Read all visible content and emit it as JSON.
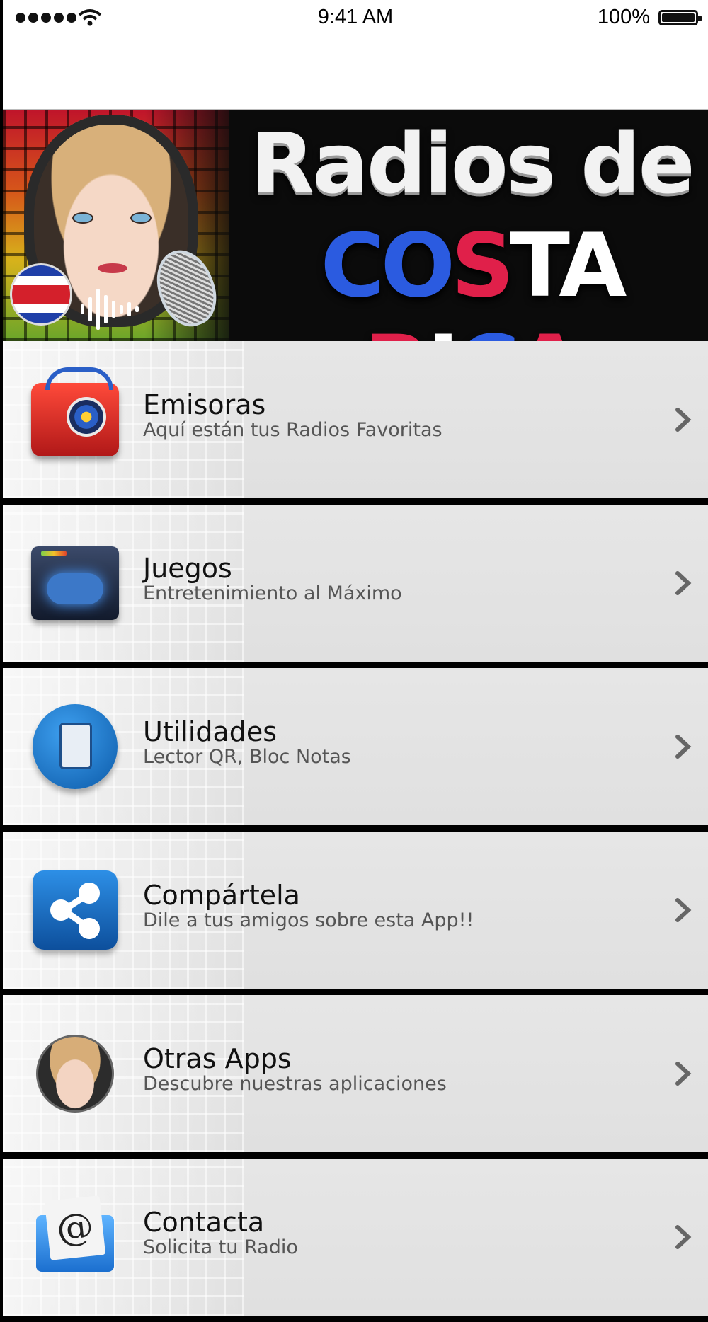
{
  "status_bar": {
    "time": "9:41 AM",
    "battery": "100%",
    "signal_icon": "signal-dots-icon",
    "wifi_icon": "wifi-icon",
    "battery_icon": "battery-icon"
  },
  "banner": {
    "line1": "Radios de",
    "line2_parts": [
      "CO",
      "S",
      "TA",
      " ",
      "R",
      "I",
      "C",
      "A"
    ],
    "colors": {
      "blue": "#2b5be0",
      "white": "#ffffff",
      "red": "#e0204a"
    }
  },
  "menu": {
    "items": [
      {
        "title": "Emisoras",
        "subtitle": "Aquí están tus Radios Favoritas",
        "icon": "radio-icon"
      },
      {
        "title": "Juegos",
        "subtitle": "Entretenimiento al Máximo",
        "icon": "gamepad-folder-icon"
      },
      {
        "title": "Utilidades",
        "subtitle": "Lector QR, Bloc Notas",
        "icon": "clipboard-icon"
      },
      {
        "title": "Compártela",
        "subtitle": "Dile a tus amigos sobre esta App!!",
        "icon": "share-icon"
      },
      {
        "title": "Otras Apps",
        "subtitle": "Descubre nuestras aplicaciones",
        "icon": "avatar-headphones-icon"
      },
      {
        "title": "Contacta",
        "subtitle": "Solicita tu Radio",
        "icon": "mail-at-icon"
      }
    ]
  },
  "mail_glyph": "@"
}
